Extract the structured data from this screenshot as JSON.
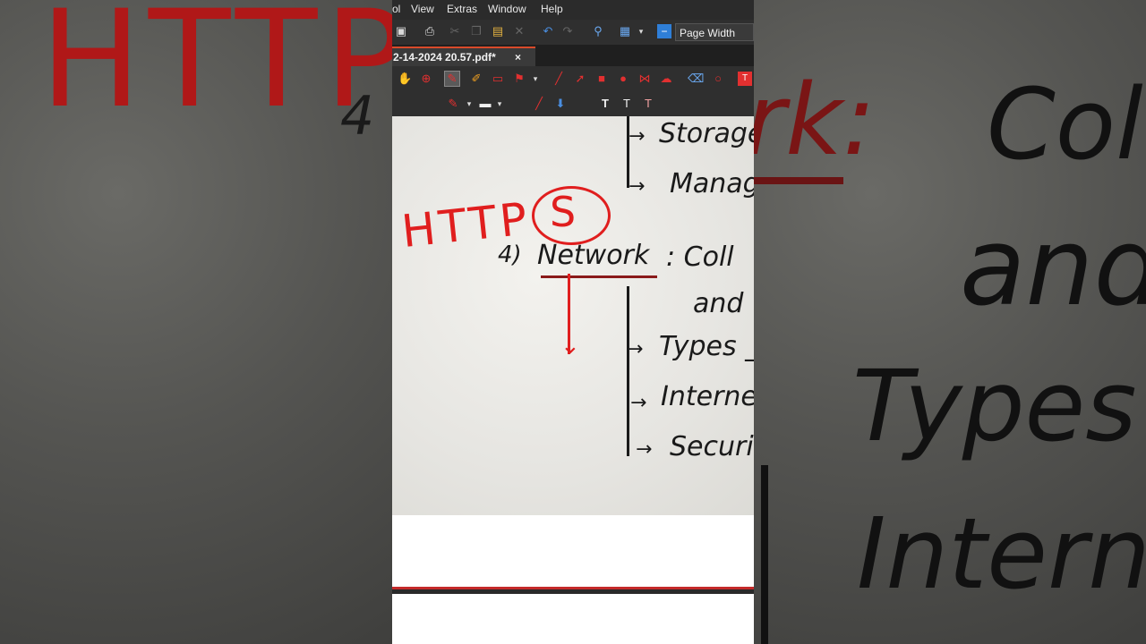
{
  "menu": {
    "items": [
      "ol",
      "View",
      "Extras",
      "Window",
      "Help"
    ]
  },
  "toolbar": {
    "zoom_value": "Page Width"
  },
  "document": {
    "tab_title": "2-14-2024 20.57.pdf*",
    "tab_close": "×"
  },
  "page": {
    "annotation_text": "HTTP",
    "annotation_circle": "S",
    "lines": {
      "storage": "Storage",
      "manage": "Manag",
      "heading_num": "4)",
      "heading": "Network",
      "colon_text": ": Coll",
      "and_text": "and",
      "types": "Types _",
      "internet": "Interne",
      "security": "Securit"
    }
  },
  "background": {
    "left_text": "HTTP",
    "right_heading": "rk:",
    "right_coll": "Coll",
    "right_and": "and",
    "right_types": "Types _",
    "right_internet": "Interne"
  },
  "colors": {
    "annotation_red": "#e01e1e",
    "toolbar_bg": "#2f2f2f",
    "menubar_bg": "#2b2b2b"
  }
}
